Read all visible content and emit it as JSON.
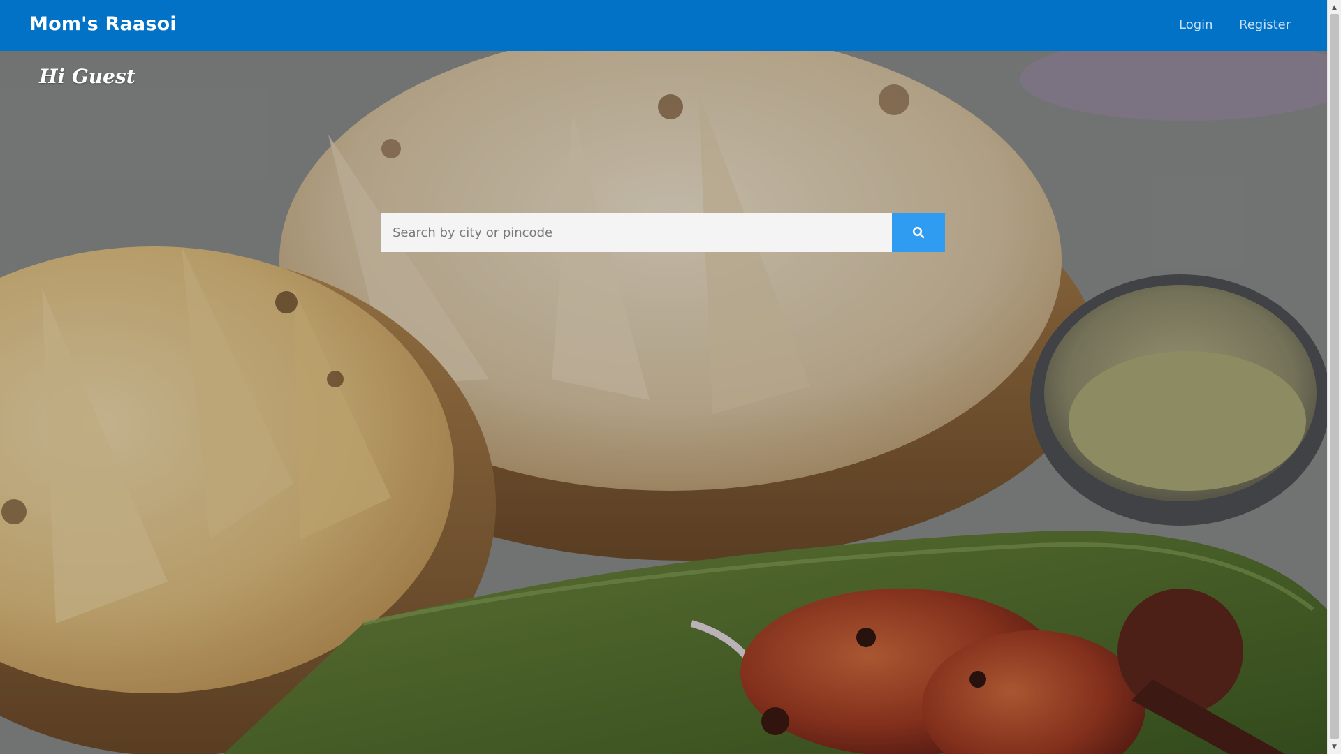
{
  "navbar": {
    "brand": "Mom's Raasoi",
    "links": [
      {
        "label": "Login"
      },
      {
        "label": "Register"
      }
    ]
  },
  "hero": {
    "greeting": "Hi Guest",
    "search": {
      "value": "",
      "placeholder": "Search by city or pincode",
      "button_icon": "search-icon"
    }
  },
  "colors": {
    "navbar_bg": "#0272c6",
    "search_button": "#2f9bf1",
    "nav_link": "#c8e1f7"
  }
}
